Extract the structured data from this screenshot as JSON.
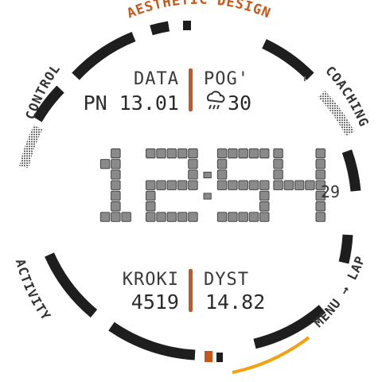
{
  "header": {
    "brand": "AESTHETIC DESIGN"
  },
  "complications": {
    "top_left_label": "DATA",
    "top_left_value": "PN 13.01",
    "top_right_label": "POG'",
    "top_right_icon": "cloud-rain-icon",
    "top_right_value": "30",
    "bottom_left_label": "KROKI",
    "bottom_left_value": "4519",
    "bottom_right_label": "DYST",
    "bottom_right_value": "14.82"
  },
  "time": {
    "hours": "12",
    "minutes": "54",
    "seconds": "29"
  },
  "buttons": {
    "control": "CONTROL",
    "coaching": "COACHING",
    "activity": "ACTIVITY",
    "menu_lap": "MENU → LAP"
  },
  "colors": {
    "accent": "#c9571c",
    "progress": "#f5a00f",
    "segments": "#1e1e1e"
  }
}
